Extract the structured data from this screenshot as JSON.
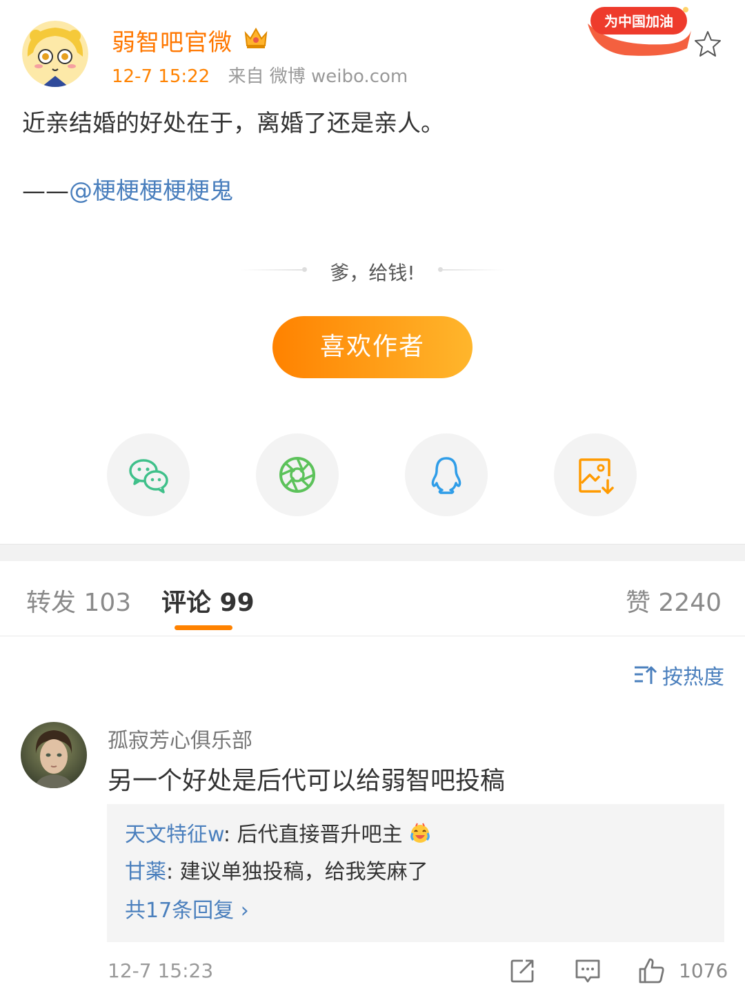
{
  "post": {
    "author": "弱智吧官微",
    "time": "12-7 15:22",
    "source": "来自 微博 weibo.com",
    "badge_text": "为中国加油",
    "content_line1": "近亲结婚的好处在于，离婚了还是亲人。",
    "content_prefix": "——",
    "content_mention": "@梗梗梗梗梗鬼"
  },
  "reward": {
    "prompt": "爹，给钱!",
    "button_label": "喜欢作者"
  },
  "share": [
    "wechat-icon",
    "moments-icon",
    "qq-icon",
    "save-image-icon"
  ],
  "tabs": {
    "repost": "转发 103",
    "comments": "评论 99",
    "likes": "赞 2240"
  },
  "sort_label": "按热度",
  "comment": {
    "user": "孤寂芳心俱乐部",
    "text": "另一个好处是后代可以给弱智吧投稿",
    "replies": [
      {
        "user": "天文特征w",
        "text": ": 后代直接晋升吧主"
      },
      {
        "user": "甘薬",
        "text": ": 建议单独投稿，给我笑麻了"
      }
    ],
    "more_replies": "共17条回复 ›",
    "time": "12-7 15:23",
    "like_count": "1076"
  },
  "colors": {
    "accent": "#ff8200",
    "link": "#4a7fbd"
  }
}
